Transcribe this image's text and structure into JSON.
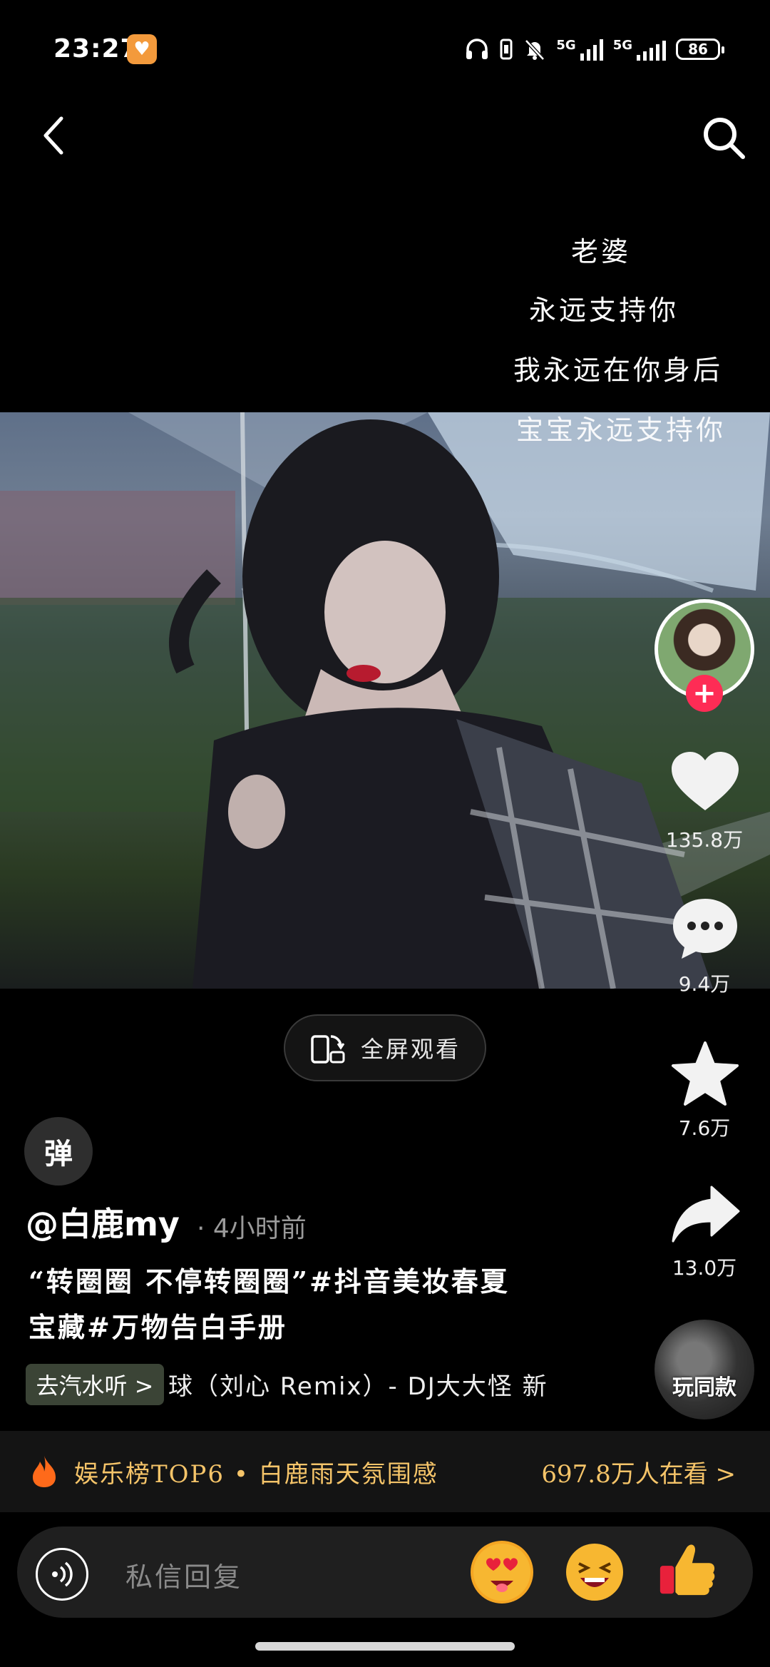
{
  "status_bar": {
    "time": "23:27",
    "network_1": "5G",
    "network_2": "5G",
    "battery": "86"
  },
  "lyrics": [
    "老婆",
    "永远支持你",
    "我永远在你身后",
    "宝宝永远支持你"
  ],
  "fullscreen": {
    "label": "全屏观看"
  },
  "danmaku": {
    "label": "弹"
  },
  "actions": {
    "likes": "135.8万",
    "comments": "9.4万",
    "favorites": "7.6万",
    "shares": "13.0万",
    "same_style": "玩同款"
  },
  "post": {
    "author": "@白鹿my",
    "time_ago": "· 4小时前",
    "caption_line1": "“转圈圈 不停转圈圈”#抖音美妆春夏",
    "caption_line2": "宝藏#万物告白手册"
  },
  "music": {
    "chip": "去汽水听 >",
    "title": "球（刘心 Remix）- DJ大大怪  新"
  },
  "ranking": {
    "text": "娱乐榜TOP6 • 白鹿雨天氛围感",
    "viewers": "697.8万人在看 >"
  },
  "message_bar": {
    "placeholder": "私信回复"
  },
  "colors": {
    "accent": "#fe2c55",
    "ranking": "#f5c469"
  }
}
